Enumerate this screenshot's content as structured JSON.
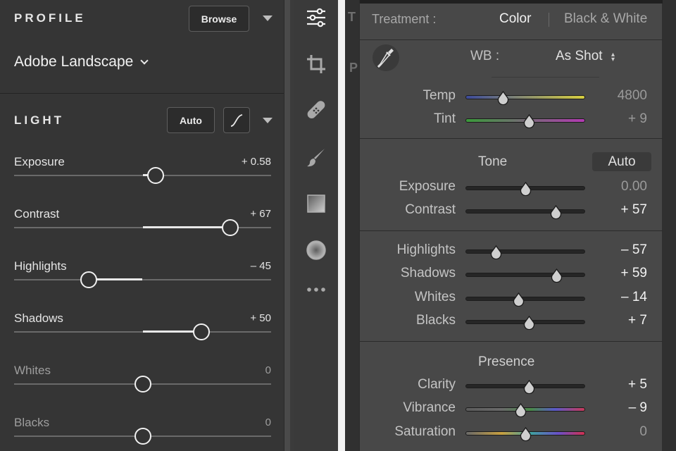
{
  "left": {
    "profile": {
      "heading": "PROFILE",
      "browse_label": "Browse",
      "name": "Adobe Landscape"
    },
    "light": {
      "heading": "LIGHT",
      "auto_label": "Auto"
    },
    "sliders": [
      {
        "label": "Exposure",
        "value": "+ 0.58",
        "position": 0.55,
        "dim": false
      },
      {
        "label": "Contrast",
        "value": "+ 67",
        "position": 0.84,
        "dim": false
      },
      {
        "label": "Highlights",
        "value": "– 45",
        "position": 0.29,
        "dim": false
      },
      {
        "label": "Shadows",
        "value": "+ 50",
        "position": 0.73,
        "dim": false
      },
      {
        "label": "Whites",
        "value": "0",
        "position": 0.5,
        "dim": true
      },
      {
        "label": "Blacks",
        "value": "0",
        "position": 0.5,
        "dim": true
      }
    ]
  },
  "tools": [
    "sliders-icon",
    "crop-icon",
    "healing-icon",
    "brush-icon",
    "gradient-icon",
    "radial-icon",
    "more-icon"
  ],
  "right": {
    "treatment": {
      "label": "Treatment :",
      "color": "Color",
      "bw": "Black & White"
    },
    "wb": {
      "label": "WB :",
      "value": "As Shot"
    },
    "wb_sliders": [
      {
        "label": "Temp",
        "value": "4800",
        "position": 0.31,
        "track": "temp",
        "dim": true
      },
      {
        "label": "Tint",
        "value": "+ 9",
        "position": 0.53,
        "track": "tint",
        "dim": true
      }
    ],
    "tone": {
      "title": "Tone",
      "auto_label": "Auto"
    },
    "tone_sliders": [
      {
        "label": "Exposure",
        "value": "0.00",
        "position": 0.5,
        "dim": true
      },
      {
        "label": "Contrast",
        "value": "+ 57",
        "position": 0.75,
        "dim": false
      }
    ],
    "region_sliders": [
      {
        "label": "Highlights",
        "value": "– 57",
        "position": 0.25,
        "dim": false
      },
      {
        "label": "Shadows",
        "value": "+ 59",
        "position": 0.76,
        "dim": false
      },
      {
        "label": "Whites",
        "value": "– 14",
        "position": 0.44,
        "dim": false
      },
      {
        "label": "Blacks",
        "value": "+ 7",
        "position": 0.53,
        "dim": false
      }
    ],
    "presence": {
      "title": "Presence"
    },
    "presence_sliders": [
      {
        "label": "Clarity",
        "value": "+ 5",
        "position": 0.53,
        "track": "plain",
        "dim": false
      },
      {
        "label": "Vibrance",
        "value": "– 9",
        "position": 0.46,
        "track": "vibrance",
        "dim": false
      },
      {
        "label": "Saturation",
        "value": "0",
        "position": 0.5,
        "track": "saturation",
        "dim": true
      }
    ]
  },
  "colors": {
    "slider_fill": "#e8e8e8",
    "temp_gradient": [
      "#3c4a9a",
      "#d8d040"
    ],
    "tint_gradient": [
      "#3a9a3a",
      "#b23ab2"
    ]
  }
}
